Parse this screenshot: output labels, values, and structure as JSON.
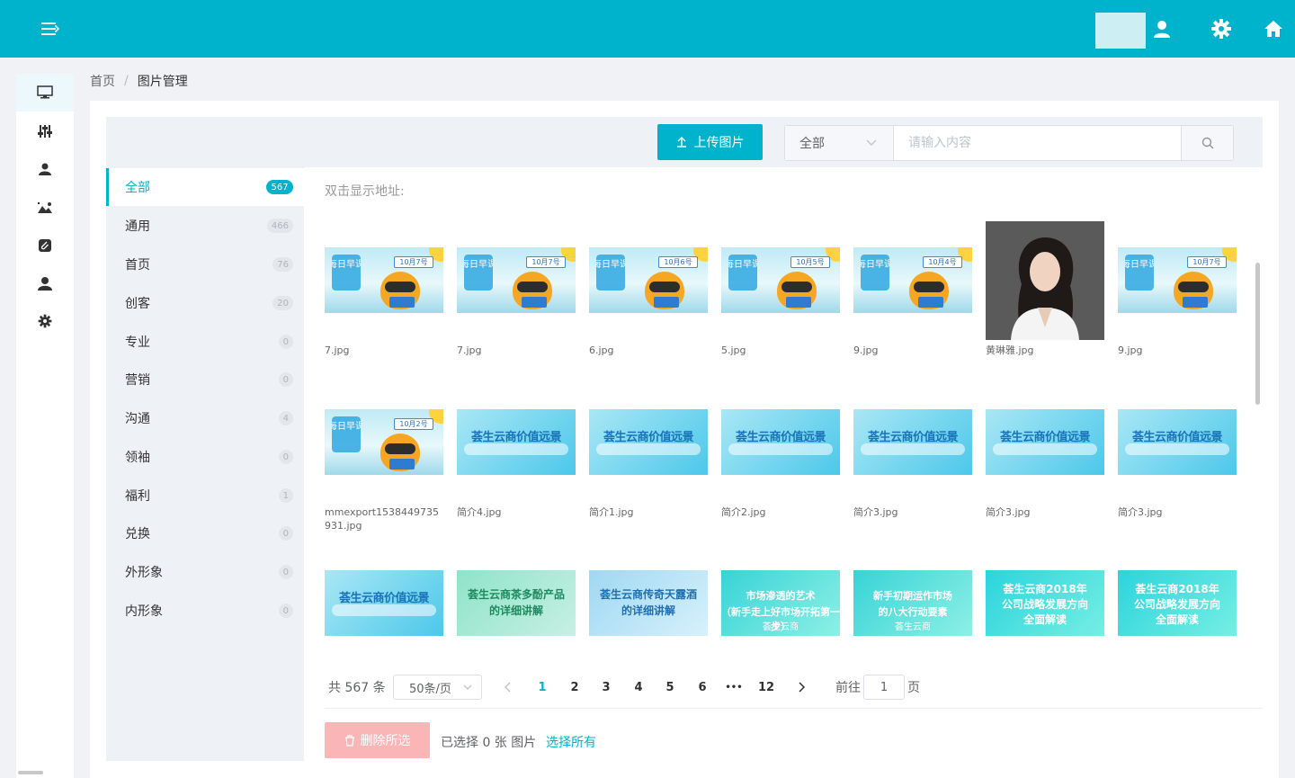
{
  "breadcrumb": {
    "home": "首页",
    "current": "图片管理"
  },
  "toolbar": {
    "upload_label": "上传图片",
    "filter_value": "全部",
    "search_placeholder": "请输入内容"
  },
  "categories": [
    {
      "label": "全部",
      "count": "567"
    },
    {
      "label": "通用",
      "count": "466"
    },
    {
      "label": "首页",
      "count": "76"
    },
    {
      "label": "创客",
      "count": "20"
    },
    {
      "label": "专业",
      "count": "0"
    },
    {
      "label": "营销",
      "count": "0"
    },
    {
      "label": "沟通",
      "count": "4"
    },
    {
      "label": "领袖",
      "count": "0"
    },
    {
      "label": "福利",
      "count": "1"
    },
    {
      "label": "兑换",
      "count": "0"
    },
    {
      "label": "外形象",
      "count": "0"
    },
    {
      "label": "内形象",
      "count": "0"
    }
  ],
  "gallery": {
    "hint": "双击显示地址:",
    "rows": [
      [
        {
          "name": "7.jpg",
          "kind": "course",
          "tag": "10月7号",
          "logo": "每日早课"
        },
        {
          "name": "7.jpg",
          "kind": "course",
          "tag": "10月7号",
          "logo": "每日早课"
        },
        {
          "name": "6.jpg",
          "kind": "course",
          "tag": "10月6号",
          "logo": "每日早课"
        },
        {
          "name": "5.jpg",
          "kind": "course",
          "tag": "10月5号",
          "logo": "每日早课"
        },
        {
          "name": "9.jpg",
          "kind": "course",
          "tag": "10月4号",
          "logo": "每日早课"
        },
        {
          "name": "黄琳雅.jpg",
          "kind": "photo"
        },
        {
          "name": "9.jpg",
          "kind": "course",
          "tag": "10月7号",
          "logo": "每日早课"
        }
      ],
      [
        {
          "name": "mmexport1538449735931.jpg",
          "kind": "course",
          "tag": "10月2号",
          "logo": "每日早课"
        },
        {
          "name": "简介4.jpg",
          "kind": "vision",
          "title": "荟生云商价值远景"
        },
        {
          "name": "简介1.jpg",
          "kind": "vision",
          "title": "荟生云商价值远景"
        },
        {
          "name": "简介2.jpg",
          "kind": "vision",
          "title": "荟生云商价值远景"
        },
        {
          "name": "简介3.jpg",
          "kind": "vision",
          "title": "荟生云商价值远景"
        },
        {
          "name": "简介3.jpg",
          "kind": "vision",
          "title": "荟生云商价值远景"
        },
        {
          "name": "简介3.jpg",
          "kind": "vision",
          "title": "荟生云商价值远景"
        }
      ],
      [
        {
          "kind": "vision",
          "title": "荟生云商价值远景"
        },
        {
          "kind": "green",
          "title": "荟生云商茶多酚产品",
          "title2": "的详细讲解"
        },
        {
          "kind": "blue2",
          "title": "荟生云商传奇天露酒",
          "title2": "的详细讲解"
        },
        {
          "kind": "market",
          "title": "市场渗透的艺术",
          "title2": "（新手走上好市场开拓第一步）",
          "brand": "荟生云商"
        },
        {
          "kind": "market",
          "title": "新手初期运作市场",
          "title2": "的八大行动要素",
          "brand": "荟生云商"
        },
        {
          "kind": "strat",
          "title": "荟生云商2018年",
          "title2": "公司战略发展方向",
          "title3": "全面解读"
        },
        {
          "kind": "strat",
          "title": "荟生云商2018年",
          "title2": "公司战略发展方向",
          "title3": "全面解读"
        }
      ]
    ]
  },
  "pagination": {
    "total_text": "共 567 条",
    "page_size": "50条/页",
    "pages": [
      "1",
      "2",
      "3",
      "4",
      "5",
      "6",
      "•••",
      "12"
    ],
    "current": "1",
    "goto_label": "前往",
    "goto_value": "1",
    "goto_suffix": "页"
  },
  "footer": {
    "delete_label": "删除所选",
    "selected_text": "已选择 0 张 图片",
    "select_all_label": "选择所有"
  },
  "colors": {
    "accent": "#00b3cc",
    "danger_light": "#fab6b6",
    "panel_bg": "#eef1f6"
  },
  "icons": {
    "menu_toggle": "menu-toggle-icon",
    "user": "user-icon",
    "settings": "gear-icon",
    "home": "home-icon",
    "sidebar": [
      "monitor-icon",
      "sliders-icon",
      "user-icon",
      "image-icon",
      "attachment-icon",
      "user-icon",
      "gear-icon"
    ]
  }
}
